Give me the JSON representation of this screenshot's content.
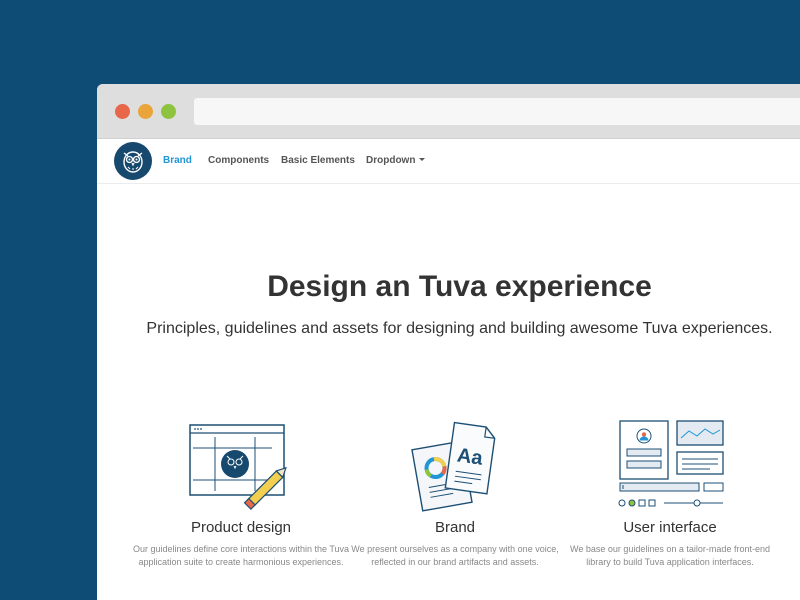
{
  "nav": {
    "items": [
      {
        "label": "Brand"
      },
      {
        "label": "Components"
      },
      {
        "label": "Basic Elements"
      },
      {
        "label": "Dropdown"
      }
    ]
  },
  "hero": {
    "title": "Design an Tuva experience",
    "subtitle": "Principles, guidelines and assets for designing and building awesome Tuva experiences."
  },
  "features": [
    {
      "title": "Product design",
      "description": "Our guidelines define core interactions within the Tuva application suite to create harmonious experiences.",
      "icon": "product-design-icon"
    },
    {
      "title": "Brand",
      "description": "We present ourselves as a company with one voice, reflected in our brand artifacts and assets.",
      "icon": "brand-icon",
      "icon_text": "Aa"
    },
    {
      "title": "User interface",
      "description": "We base our guidelines on a tailor-made front-end library to build Tuva application interfaces.",
      "icon": "user-interface-icon"
    }
  ],
  "colors": {
    "background": "#0f4c75",
    "accent": "#2196d6",
    "logo": "#17486e"
  }
}
